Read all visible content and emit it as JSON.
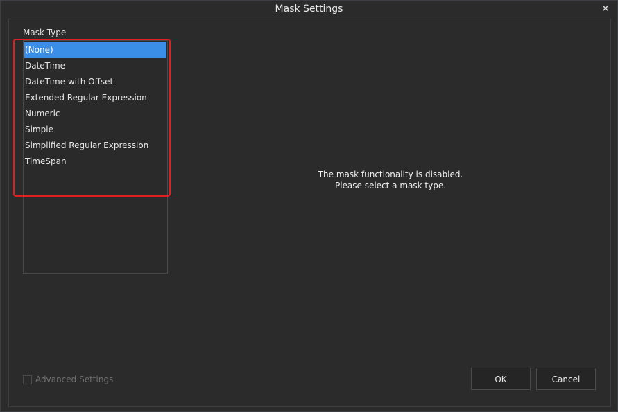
{
  "window": {
    "title": "Mask Settings",
    "close_glyph": "✕"
  },
  "mask_type": {
    "label": "Mask Type",
    "items": [
      {
        "label": "(None)",
        "selected": true
      },
      {
        "label": "DateTime",
        "selected": false
      },
      {
        "label": "DateTime with Offset",
        "selected": false
      },
      {
        "label": "Extended Regular Expression",
        "selected": false
      },
      {
        "label": "Numeric",
        "selected": false
      },
      {
        "label": "Simple",
        "selected": false
      },
      {
        "label": "Simplified Regular Expression",
        "selected": false
      },
      {
        "label": "TimeSpan",
        "selected": false
      }
    ]
  },
  "message": {
    "line1": "The mask functionality is disabled.",
    "line2": "Please select a mask type."
  },
  "advanced_settings": {
    "label": "Advanced Settings",
    "checked": false,
    "enabled": false
  },
  "buttons": {
    "ok": "OK",
    "cancel": "Cancel"
  },
  "colors": {
    "selection": "#3a8ee8",
    "highlight": "#e02020",
    "background": "#2b2b2b"
  }
}
